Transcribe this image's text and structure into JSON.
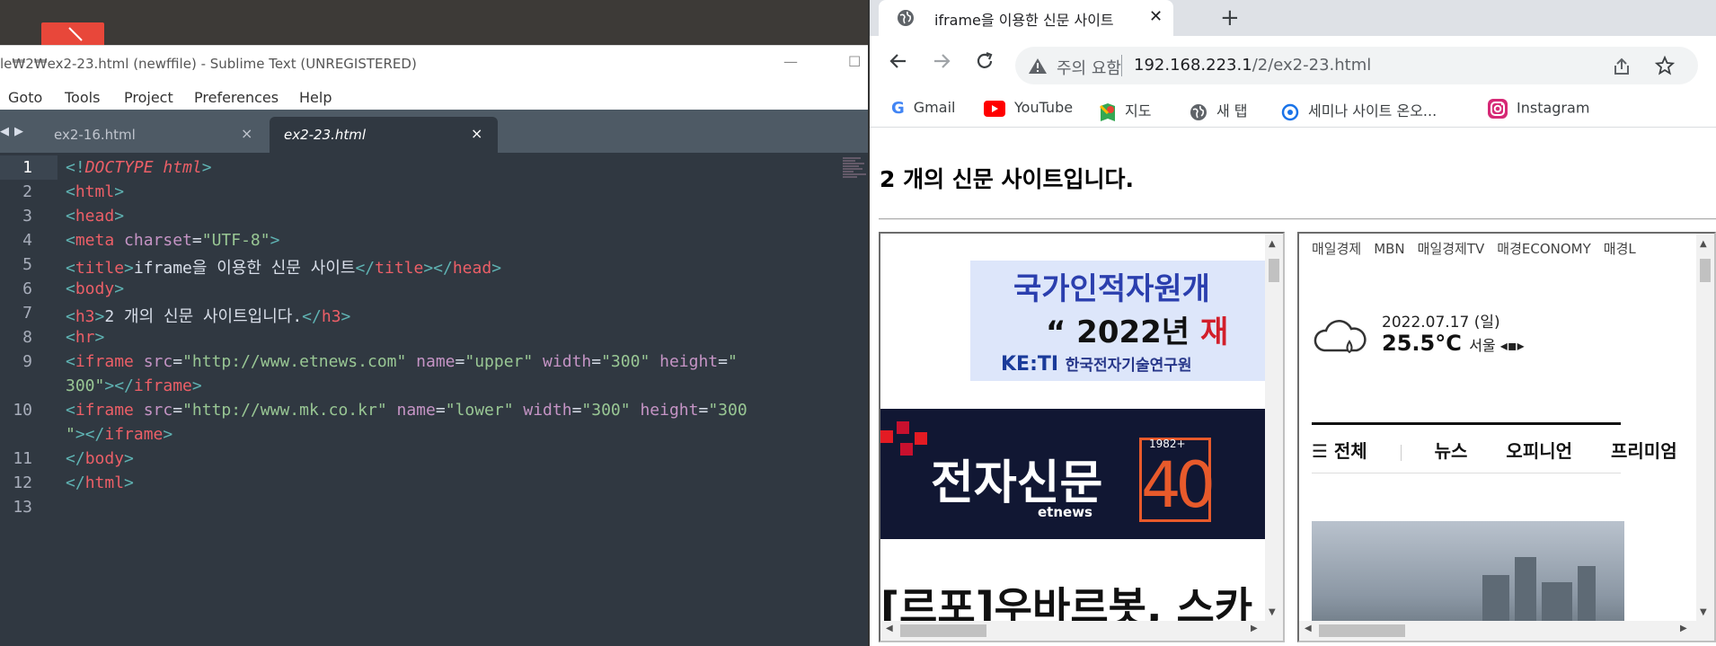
{
  "sublime": {
    "title": "le₩2₩ex2-23.html (newffile) - Sublime Text (UNREGISTERED)",
    "menu": [
      "Goto",
      "Tools",
      "Project",
      "Preferences",
      "Help"
    ],
    "tabs": [
      {
        "label": "ex2-16.html",
        "active": false
      },
      {
        "label": "ex2-23.html",
        "active": true
      }
    ],
    "current_line": "1",
    "line_numbers": [
      "1",
      "2",
      "3",
      "4",
      "5",
      "6",
      "7",
      "8",
      "9",
      "",
      "10",
      "",
      "11",
      "12",
      "13"
    ],
    "code": {
      "l1": {
        "a": "<!",
        "b": "DOCTYPE",
        "c": " ",
        "d": "html",
        "e": ">"
      },
      "l2": {
        "a": "<",
        "b": "html",
        "c": ">"
      },
      "l3": {
        "a": "<",
        "b": "head",
        "c": ">"
      },
      "l4": {
        "a": "<",
        "b": "meta",
        "c": " ",
        "d": "charset",
        "e": "=",
        "f": "\"UTF-8\"",
        "g": ">"
      },
      "l5": {
        "a": "<",
        "b": "title",
        "c": ">",
        "d": "iframe을 이용한 신문 사이트",
        "e": "</",
        "f": "title",
        "g": "></",
        "h": "head",
        "i": ">"
      },
      "l6": {
        "a": "<",
        "b": "body",
        "c": ">"
      },
      "l7": {
        "a": "<",
        "b": "h3",
        "c": ">",
        "d": "2 개의 신문 사이트입니다.",
        "e": "</",
        "f": "h3",
        "g": ">"
      },
      "l8": {
        "a": "<",
        "b": "hr",
        "c": ">"
      },
      "l9": {
        "a": "<",
        "b": "iframe",
        "c": " src",
        "d": "=",
        "e": "\"http://www.etnews.com\"",
        "f": " name",
        "g": "=",
        "h": "\"upper\"",
        "i": " width",
        "j": "=",
        "k": "\"300\"",
        "l": " height",
        "m": "=",
        "n": "\""
      },
      "l9b": {
        "a": "300\"",
        "b": "></",
        "c": "iframe",
        "d": ">"
      },
      "l10": {
        "a": "<",
        "b": "iframe",
        "c": " src",
        "d": "=",
        "e": "\"http://www.mk.co.kr\"",
        "f": " name",
        "g": "=",
        "h": "\"lower\"",
        "i": " width",
        "j": "=",
        "k": "\"300\"",
        "l": " height",
        "m": "=",
        "n": "\"300"
      },
      "l10b": {
        "a": "\"",
        "b": "></",
        "c": "iframe",
        "d": ">"
      },
      "l11": {
        "a": "</",
        "b": "body",
        "c": ">"
      },
      "l12": {
        "a": "</",
        "b": "html",
        "c": ">"
      }
    }
  },
  "browser": {
    "tab_title": "iframe을 이용한 신문 사이트",
    "security_label": "주의 요함",
    "url_host": "192.168.223.1",
    "url_path": "/2/ex2-23.html",
    "bookmarks": [
      "Gmail",
      "YouTube",
      "지도",
      "새 탭",
      "세미나 사이트 온오...",
      "Instagram"
    ]
  },
  "page": {
    "heading": "2 개의 신문 사이트입니다.",
    "etnews": {
      "banner_line1": "국가인적자원개",
      "banner_line2_a": "“ 2022년 ",
      "banner_line2_b": "재",
      "banner_logo": "KE:TI",
      "banner_org": "한국전자기술연구원",
      "brand": "전자신문",
      "brand_sub": "etnews",
      "anniv_year": "1982+",
      "anniv_number": "40",
      "headline": "[르포]우바르봇, 스카"
    },
    "mk": {
      "nav": [
        "매일경제",
        "MBN",
        "매일경제TV",
        "매경ECONOMY",
        "매경L"
      ],
      "weather_date": "2022.07.17 (일)",
      "weather_temp": "25.5°C",
      "weather_city": "서울 ◂▪▸",
      "menu_all": "☰ 전체",
      "menu": [
        "뉴스",
        "오피니언",
        "프리미엄"
      ]
    }
  },
  "colors": {
    "editor_bg": "#303841",
    "tag": "#5fb3b3",
    "name": "#ec5f67",
    "attr": "#c594c5",
    "string": "#99c794",
    "etnews_navy": "#111733",
    "accent_red": "#e31b23"
  }
}
